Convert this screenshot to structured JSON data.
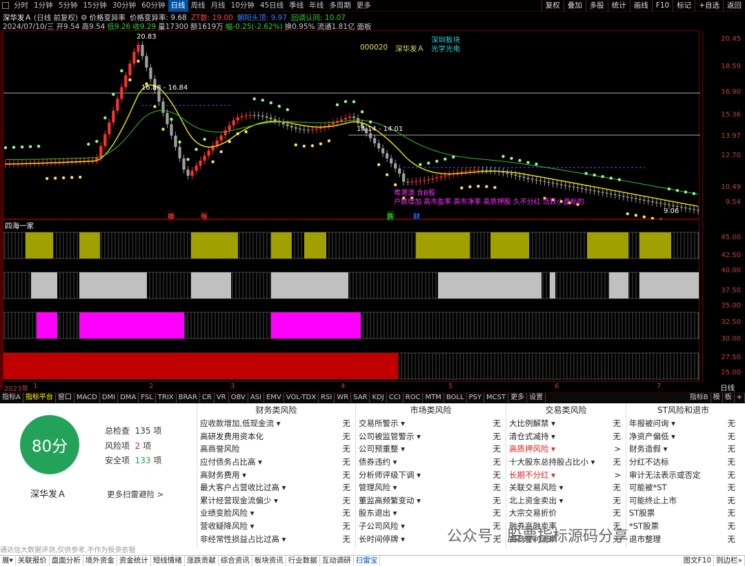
{
  "period_tabs": [
    {
      "label": "分时"
    },
    {
      "label": "1分钟"
    },
    {
      "label": "5分钟"
    },
    {
      "label": "15分钟"
    },
    {
      "label": "30分钟"
    },
    {
      "label": "60分钟"
    },
    {
      "label": "日线"
    },
    {
      "label": "周线"
    },
    {
      "label": "月线"
    },
    {
      "label": "10分钟"
    },
    {
      "label": "45日线"
    },
    {
      "label": "季线"
    },
    {
      "label": "年线"
    },
    {
      "label": "多周期"
    },
    {
      "label": "更多"
    }
  ],
  "active_period": "日线",
  "right_tabs": [
    {
      "label": "复权"
    },
    {
      "label": "叠加"
    },
    {
      "label": "多股"
    },
    {
      "label": "统计"
    },
    {
      "label": "画线"
    },
    {
      "label": "F10"
    },
    {
      "label": "标记"
    },
    {
      "label": "+自选"
    },
    {
      "label": "返回"
    }
  ],
  "header": {
    "stock": "深华发Ａ",
    "adj": "(日线 前复权)",
    "ind1": "价格变异率",
    "ind2": "价格变异率: 9.68",
    "zt": "ZT数: 19.00",
    "mrt": "朝阳头顶: 9.97",
    "hd": "回调认同: 10.07"
  },
  "quote": {
    "date": "2024/07/10/三",
    "open": "开9.54",
    "high": "高9.54",
    "low": "低9.26",
    "close": "收9.29",
    "vol": "量17300",
    "amt": "额1619万",
    "chg": "幅-0.25(-2.62%)",
    "turn": "换0.95%",
    "flow": "流通1.81亿",
    "face": "面板"
  },
  "main_labels": {
    "code": "000020",
    "name": "深华发Ａ",
    "sector1": "深圳板块",
    "sector2": "光学光电",
    "peak": "20.83",
    "range1": "16.88 - 16.84",
    "range2": "14.14 - 14.01",
    "low": "9.06",
    "note1": "粤港澳 含B股",
    "note2": "户数增加 高市盈率 高市净率 高质押股 久不分红 活跃小盘标的",
    "m1": "换",
    "m2": "张",
    "m3": "跌",
    "m4": "财"
  },
  "price_ticks": [
    "20.45",
    "18.59",
    "16.90",
    "15.36",
    "13.97",
    "12.70",
    "10.49",
    "9.54"
  ],
  "sub_title": "四海一家",
  "sub_ticks": [
    "45.00",
    "42.50",
    "40.00",
    "37.50",
    "35.00",
    "32.50",
    "30.00",
    "27.50",
    "25.00"
  ],
  "time_labels": [
    "2023年",
    "1",
    "2",
    "3",
    "4",
    "5",
    "6",
    "7"
  ],
  "time_right": "日线",
  "chart_data": {
    "type": "candlestick",
    "title": "",
    "peak": 20.83,
    "low": 9.06,
    "ylim": [
      9.0,
      21.0
    ]
  },
  "ind_tabs": [
    {
      "label": "指标A"
    },
    {
      "label": "指标平台"
    },
    {
      "label": "窗口"
    },
    {
      "label": "MACD"
    },
    {
      "label": "DMI"
    },
    {
      "label": "DMA"
    },
    {
      "label": "FSL"
    },
    {
      "label": "TRIX"
    },
    {
      "label": "BRAR"
    },
    {
      "label": "CR"
    },
    {
      "label": "VR"
    },
    {
      "label": "OBV"
    },
    {
      "label": "ASI"
    },
    {
      "label": "EMV"
    },
    {
      "label": "VOL-TDX"
    },
    {
      "label": "RSI"
    },
    {
      "label": "WR"
    },
    {
      "label": "SAR"
    },
    {
      "label": "KDJ"
    },
    {
      "label": "CCI"
    },
    {
      "label": "ROC"
    },
    {
      "label": "MTM"
    },
    {
      "label": "BOLL"
    },
    {
      "label": "PSY"
    },
    {
      "label": "MCST"
    },
    {
      "label": "更多"
    },
    {
      "label": "设置"
    }
  ],
  "ind_right": {
    "a": "指标B",
    "b": "模",
    "c": "板",
    "d": "+"
  },
  "scan": {
    "score": "80分",
    "total_label": "总检查",
    "total": "135",
    "risk_label": "风险项",
    "risk": "2",
    "safe_label": "安全项",
    "safe": "133",
    "unit": "项",
    "stock": "深华发Ａ",
    "more": "更多扫雷避险 >"
  },
  "risk_cols": [
    {
      "title": "财务类风险",
      "items": [
        [
          "应收款增加,低现金流 ▾",
          "无"
        ],
        [
          "高研发费用资本化",
          "无"
        ],
        [
          "高商誉风险",
          "无"
        ],
        [
          "应付债务占比高 ▾",
          "无"
        ],
        [
          "高财务费用 ▾",
          "无"
        ],
        [
          "最大客户占营收比过高 ▾",
          "无"
        ],
        [
          "累计经营现金流偏少 ▾",
          "无"
        ],
        [
          "业绩变脸风险 ▾",
          "无"
        ],
        [
          "营收疑降风险 ▾",
          "无"
        ],
        [
          "非经常性损益占比过高 ▾",
          "无"
        ]
      ]
    },
    {
      "title": "市场类风险",
      "items": [
        [
          "交易所警示 ▾",
          "无"
        ],
        [
          "公司被监管警示 ▾",
          "无"
        ],
        [
          "公司预重整 ▾",
          "无"
        ],
        [
          "债券违约 ▾",
          "无"
        ],
        [
          "分析师评级下调 ▾",
          "无"
        ],
        [
          "管理风险 ▾",
          "无"
        ],
        [
          "董监高频繁变动 ▾",
          "无"
        ],
        [
          "股东退出 ▾",
          "无"
        ],
        [
          "子公司风险 ▾",
          "无"
        ],
        [
          "长时间停牌 ▾",
          "无"
        ]
      ]
    },
    {
      "title": "交易类风险",
      "items": [
        [
          "大比例解禁 ▾",
          "无"
        ],
        [
          "清仓式减持 ▾",
          "无"
        ],
        [
          "高质押风险 ▾",
          ">"
        ],
        [
          "十大股东总持股占比小 ▾",
          "无"
        ],
        [
          "长期不分红 ▾",
          ">"
        ],
        [
          "关联交易风险 ▾",
          "无"
        ],
        [
          "北上资金卖出 ▾",
          "无"
        ],
        [
          "大宗交易折价",
          "无"
        ],
        [
          "融券高融卖率",
          "无"
        ],
        [
          "高商誉利润率",
          "无"
        ]
      ]
    },
    {
      "title": "ST风险和退市",
      "items": [
        [
          "年报被问询 ▾",
          "无"
        ],
        [
          "净资产偏低 ▾",
          "无"
        ],
        [
          "财务造假 ▾",
          "无"
        ],
        [
          "分红不达标",
          "无"
        ],
        [
          "审计无法表示或否定",
          "无"
        ],
        [
          "可能被*ST",
          "无"
        ],
        [
          "可能终止上市",
          "无"
        ],
        [
          "ST股票",
          "无"
        ],
        [
          "*ST股票",
          "无"
        ],
        [
          "退市整理",
          "无"
        ]
      ]
    }
  ],
  "disclaimer": "通达信大数据评测,仅供参考,不作为投资依据",
  "watermark": "公众号 · 股票指标源码分享",
  "bottom_tabs": [
    {
      "label": "展▾"
    },
    {
      "label": "关联报价"
    },
    {
      "label": "盘面分析"
    },
    {
      "label": "境外资金"
    },
    {
      "label": "资金统计"
    },
    {
      "label": "短线情绪"
    },
    {
      "label": "涨跌贡献"
    },
    {
      "label": "综合资讯"
    },
    {
      "label": "板块资讯"
    },
    {
      "label": "行业数据"
    },
    {
      "label": "互动调研"
    },
    {
      "label": "扫雷宝"
    }
  ],
  "bottom_right": "图文F10",
  "bottom_right2": "则边栏»",
  "colors": {
    "up": "#ff3030",
    "down": "#a0a0a0",
    "ma": "#e8e000",
    "ma2": "#30c030",
    "dots": "#90ff90",
    "olive": "#a0a000",
    "gray": "#c0c0c0",
    "magenta": "#ff00ff",
    "red": "#c00000"
  }
}
